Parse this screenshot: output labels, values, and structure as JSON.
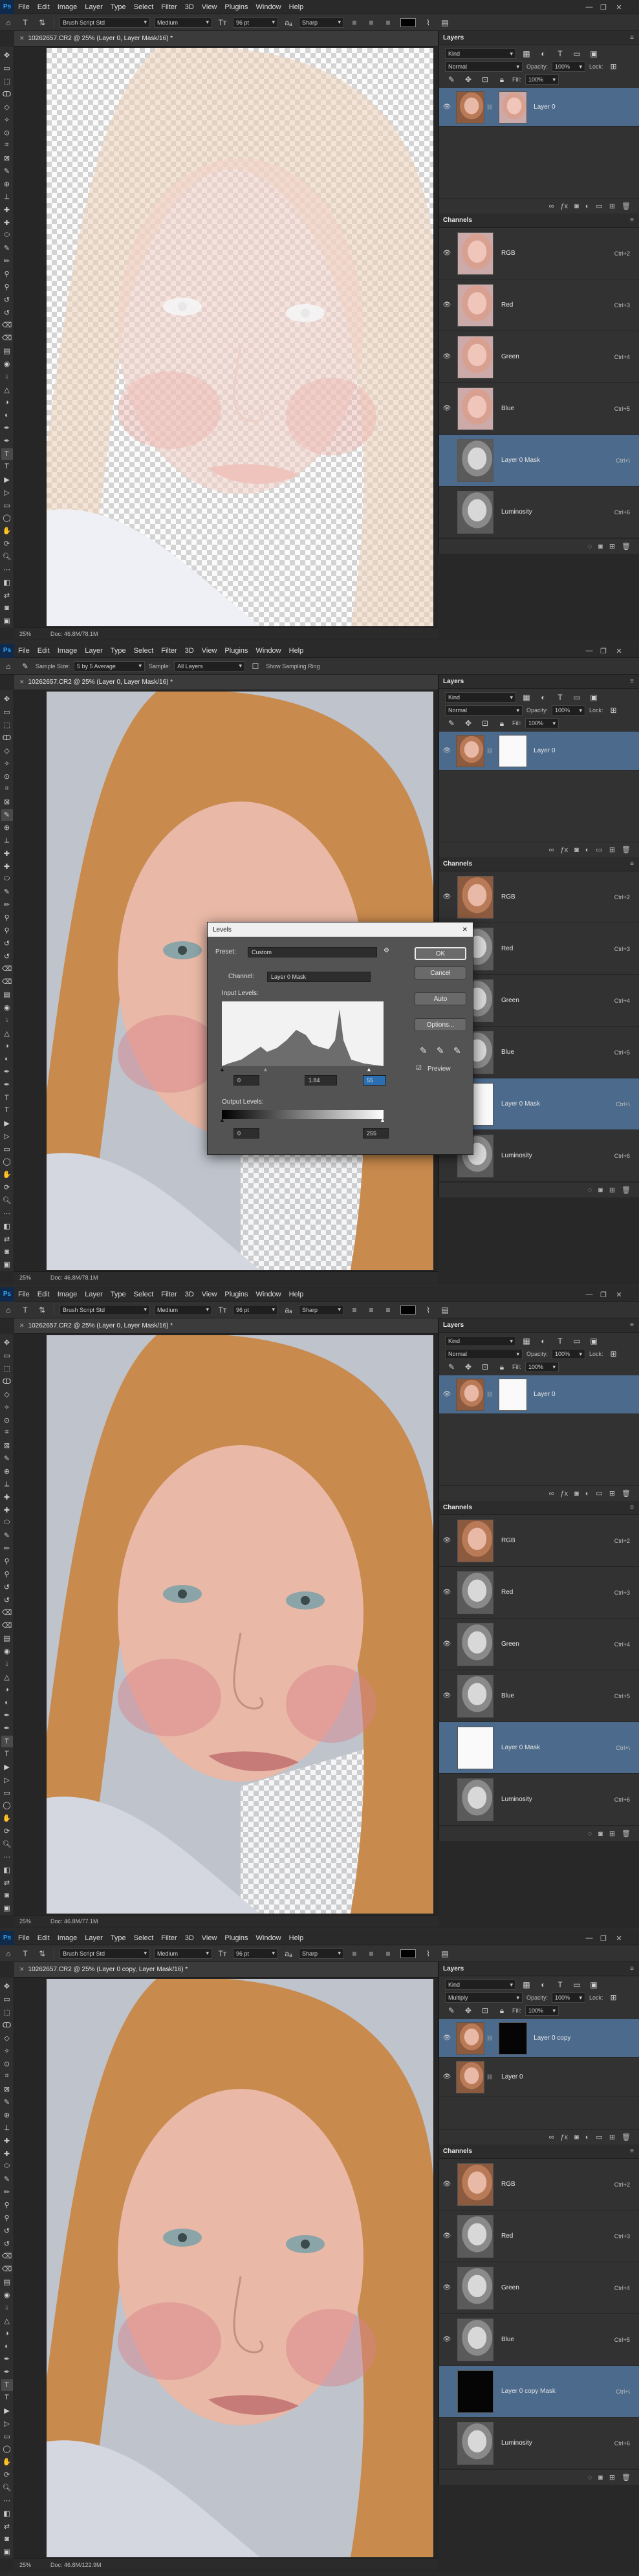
{
  "app": {
    "logo": "Ps",
    "menus": [
      "File",
      "Edit",
      "Image",
      "Layer",
      "Type",
      "Select",
      "Filter",
      "3D",
      "View",
      "Plugins",
      "Window",
      "Help"
    ],
    "window_controls": [
      "minimize-icon",
      "restore-icon",
      "close-icon"
    ]
  },
  "optbar_brush": {
    "font": "Brush Script Std",
    "style": "Medium",
    "size": "96 pt",
    "aa": "Sharp"
  },
  "optbar_eyedrop": {
    "sample_size_label": "Sample Size:",
    "sample_size": "5 by 5 Average",
    "sample_label": "Sample:",
    "sample": "All Layers",
    "ring": "Show Sampling Ring"
  },
  "panels": {
    "layers_title": "Layers",
    "channels_title": "Channels",
    "kind": "Kind",
    "opacity_label": "Opacity:",
    "opacity": "100%",
    "lock_label": "Lock:",
    "fill_label": "Fill:",
    "fill": "100%"
  },
  "shots": [
    {
      "doc_title": "10262657.CR2 @ 25% (Layer 0, Layer Mask/16) *",
      "zoom": "25%",
      "doc_size": "Doc: 46.8M/78.1M",
      "blend": "Normal",
      "layers": [
        {
          "name": "Layer 0"
        }
      ],
      "channels": [
        {
          "name": "RGB",
          "key": "Ctrl+2"
        },
        {
          "name": "Red",
          "key": "Ctrl+3"
        },
        {
          "name": "Green",
          "key": "Ctrl+4"
        },
        {
          "name": "Blue",
          "key": "Ctrl+5"
        },
        {
          "name": "Layer 0 Mask",
          "key": "Ctrl+\\"
        },
        {
          "name": "Luminosity",
          "key": "Ctrl+6"
        }
      ]
    },
    {
      "doc_title": "10262657.CR2 @ 25% (Layer 0, Layer Mask/16) *",
      "zoom": "25%",
      "doc_size": "Doc: 46.8M/78.1M",
      "blend": "Normal",
      "layers": [
        {
          "name": "Layer 0"
        }
      ],
      "channels": [
        {
          "name": "RGB",
          "key": "Ctrl+2"
        },
        {
          "name": "Red",
          "key": "Ctrl+3"
        },
        {
          "name": "Green",
          "key": "Ctrl+4"
        },
        {
          "name": "Blue",
          "key": "Ctrl+5"
        },
        {
          "name": "Layer 0 Mask",
          "key": "Ctrl+\\"
        },
        {
          "name": "Luminosity",
          "key": "Ctrl+6"
        }
      ]
    },
    {
      "doc_title": "10262657.CR2 @ 25% (Layer 0, Layer Mask/16) *",
      "zoom": "25%",
      "doc_size": "Doc: 46.8M/77.1M",
      "blend": "Normal",
      "layers": [
        {
          "name": "Layer 0"
        }
      ],
      "channels": [
        {
          "name": "RGB",
          "key": "Ctrl+2"
        },
        {
          "name": "Red",
          "key": "Ctrl+3"
        },
        {
          "name": "Green",
          "key": "Ctrl+4"
        },
        {
          "name": "Blue",
          "key": "Ctrl+5"
        },
        {
          "name": "Layer 0 Mask",
          "key": "Ctrl+\\"
        },
        {
          "name": "Luminosity",
          "key": "Ctrl+6"
        }
      ]
    },
    {
      "doc_title": "10262657.CR2 @ 25% (Layer 0 copy, Layer Mask/16) *",
      "zoom": "25%",
      "doc_size": "Doc: 46.8M/122.9M",
      "blend": "Multiply",
      "layers": [
        {
          "name": "Layer 0 copy"
        },
        {
          "name": "Layer 0"
        }
      ],
      "channels": [
        {
          "name": "RGB",
          "key": "Ctrl+2"
        },
        {
          "name": "Red",
          "key": "Ctrl+3"
        },
        {
          "name": "Green",
          "key": "Ctrl+4"
        },
        {
          "name": "Blue",
          "key": "Ctrl+5"
        },
        {
          "name": "Layer 0 copy Mask",
          "key": "Ctrl+\\"
        },
        {
          "name": "Luminosity",
          "key": "Ctrl+6"
        }
      ]
    }
  ],
  "levels_dialog": {
    "title": "Levels",
    "preset_label": "Preset:",
    "preset": "Custom",
    "channel_label": "Channel:",
    "channel": "Layer 0 Mask",
    "input_label": "Input Levels:",
    "input_black": "0",
    "input_gamma": "1.84",
    "input_white": "55",
    "output_label": "Output Levels:",
    "output_black": "0",
    "output_white": "255",
    "ok": "OK",
    "cancel": "Cancel",
    "auto": "Auto",
    "options": "Options...",
    "preview": "Preview"
  }
}
